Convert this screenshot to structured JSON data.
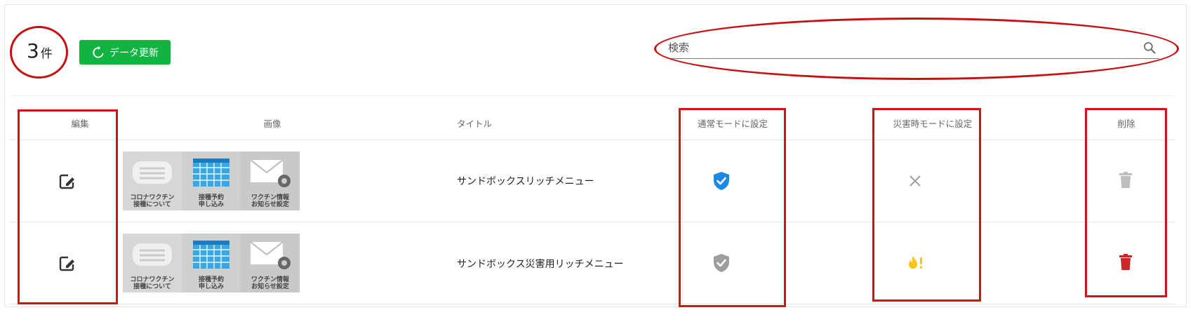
{
  "toolbar": {
    "count_value": "3",
    "count_unit": "件",
    "refresh_label": "データ更新",
    "search_placeholder": "検索"
  },
  "table": {
    "headers": {
      "edit": "編集",
      "image": "画像",
      "title": "タイトル",
      "normal_mode": "通常モードに設定",
      "disaster_mode": "災害時モードに設定",
      "delete": "削除"
    },
    "rows": [
      {
        "title": "サンドボックスリッチメニュー",
        "thumbs": [
          {
            "line1": "コロナワクチン",
            "line2": "接種について"
          },
          {
            "line1": "接種予約",
            "line2": "申し込み"
          },
          {
            "line1": "ワクチン情報",
            "line2": "お知らせ設定"
          }
        ],
        "normal_mode": "active",
        "disaster_mode": "inactive",
        "delete": "disabled"
      },
      {
        "title": "サンドボックス災害用リッチメニュー",
        "thumbs": [
          {
            "line1": "コロナワクチン",
            "line2": "接種について"
          },
          {
            "line1": "接種予約",
            "line2": "申し込み"
          },
          {
            "line1": "ワクチン情報",
            "line2": "お知らせ設定"
          }
        ],
        "normal_mode": "inactive",
        "disaster_mode": "active",
        "delete": "enabled"
      }
    ]
  },
  "colors": {
    "refresh_button": "#12b441",
    "active_shield": "#1e88e5",
    "inactive_shield": "#9e9e9e",
    "disaster_active": "#f5c518",
    "delete_enabled": "#c62828",
    "delete_disabled": "#bdbdbd",
    "annotation": "#d11414"
  },
  "icons": {
    "refresh": "refresh-icon",
    "search": "search-icon",
    "edit": "edit-note-icon",
    "normal_active": "shield-check-icon",
    "disaster_inactive": "close-icon",
    "disaster_active": "fire-alert-icon",
    "delete": "trash-icon"
  }
}
